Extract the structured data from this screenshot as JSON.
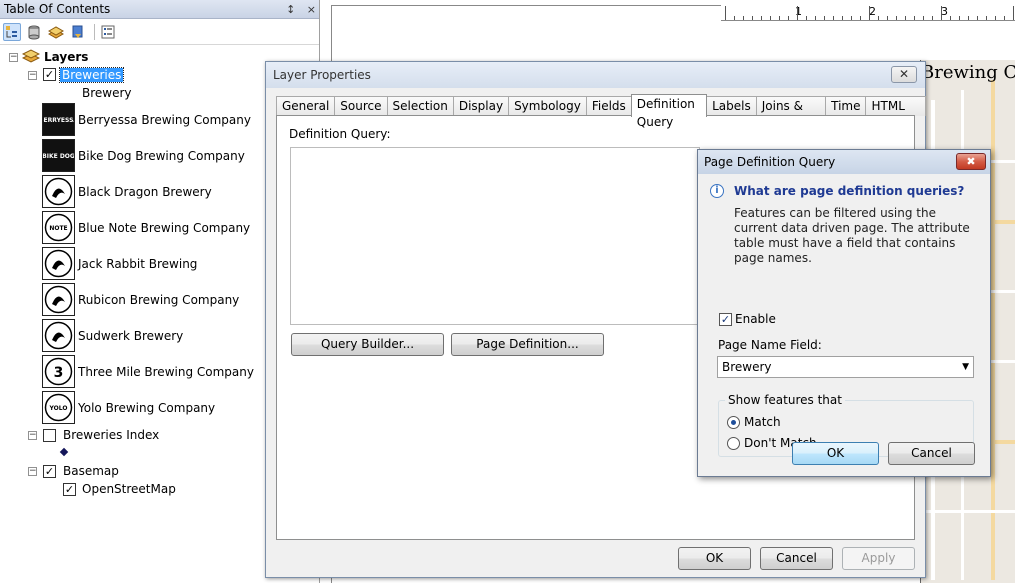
{
  "toc": {
    "title": "Table Of Contents",
    "pin": "↕",
    "close": "×",
    "toolbar": [
      "list-by-drawing-order-icon",
      "list-by-source-icon",
      "list-by-visibility-icon",
      "list-by-selection-icon",
      "options-icon"
    ],
    "layers_root": "Layers",
    "breweries_layer": "Breweries",
    "breweries_field": "Brewery",
    "breweries": [
      "Berryessa Brewing Company",
      "Bike Dog Brewing Company",
      "Black Dragon Brewery",
      "Blue Note Brewing Company",
      "Jack Rabbit Brewing",
      "Rubicon Brewing Company",
      "Sudwerk Brewery",
      "Three Mile Brewing Company",
      "Yolo Brewing Company"
    ],
    "thumb_texts": [
      "BERRYESSA",
      "BIKE DOG",
      "",
      "NOTE",
      "",
      "",
      "",
      "3",
      "YOLO"
    ],
    "breweries_index": "Breweries Index",
    "basemap": "Basemap",
    "openstreetmap": "OpenStreetMap",
    "expand_glyph": "−",
    "check_glyph": "✓"
  },
  "layout": {
    "ruler_numbers": [
      "1",
      "2",
      "3"
    ],
    "map_title": "Brewing Co"
  },
  "layer_properties": {
    "title": "Layer Properties",
    "tabs": [
      "General",
      "Source",
      "Selection",
      "Display",
      "Symbology",
      "Fields",
      "Definition Query",
      "Labels",
      "Joins & Relates",
      "Time",
      "HTML Popup"
    ],
    "active_tab": "Definition Query",
    "definition_query_label": "Definition Query:",
    "definition_query_value": "",
    "query_builder_btn": "Query Builder...",
    "page_definition_btn": "Page Definition...",
    "ok": "OK",
    "cancel": "Cancel",
    "apply": "Apply"
  },
  "page_def": {
    "title": "Page Definition Query",
    "close": "✖",
    "info_glyph": "i",
    "heading": "What are page definition queries?",
    "description": "Features can be filtered using the current data driven page.  The attribute table must have a field that contains page names.",
    "enable_label": "Enable",
    "enable_checked": true,
    "page_name_field_label": "Page Name Field:",
    "page_name_field_value": "Brewery",
    "dropdown_arrow": "▼",
    "show_features_label": "Show features that",
    "match": "Match",
    "dont_match": "Don't Match",
    "selected_option": "Match",
    "ok": "OK",
    "cancel": "Cancel"
  },
  "colors": {
    "selection": "#3399ff",
    "heading_blue": "#1f3a93"
  }
}
